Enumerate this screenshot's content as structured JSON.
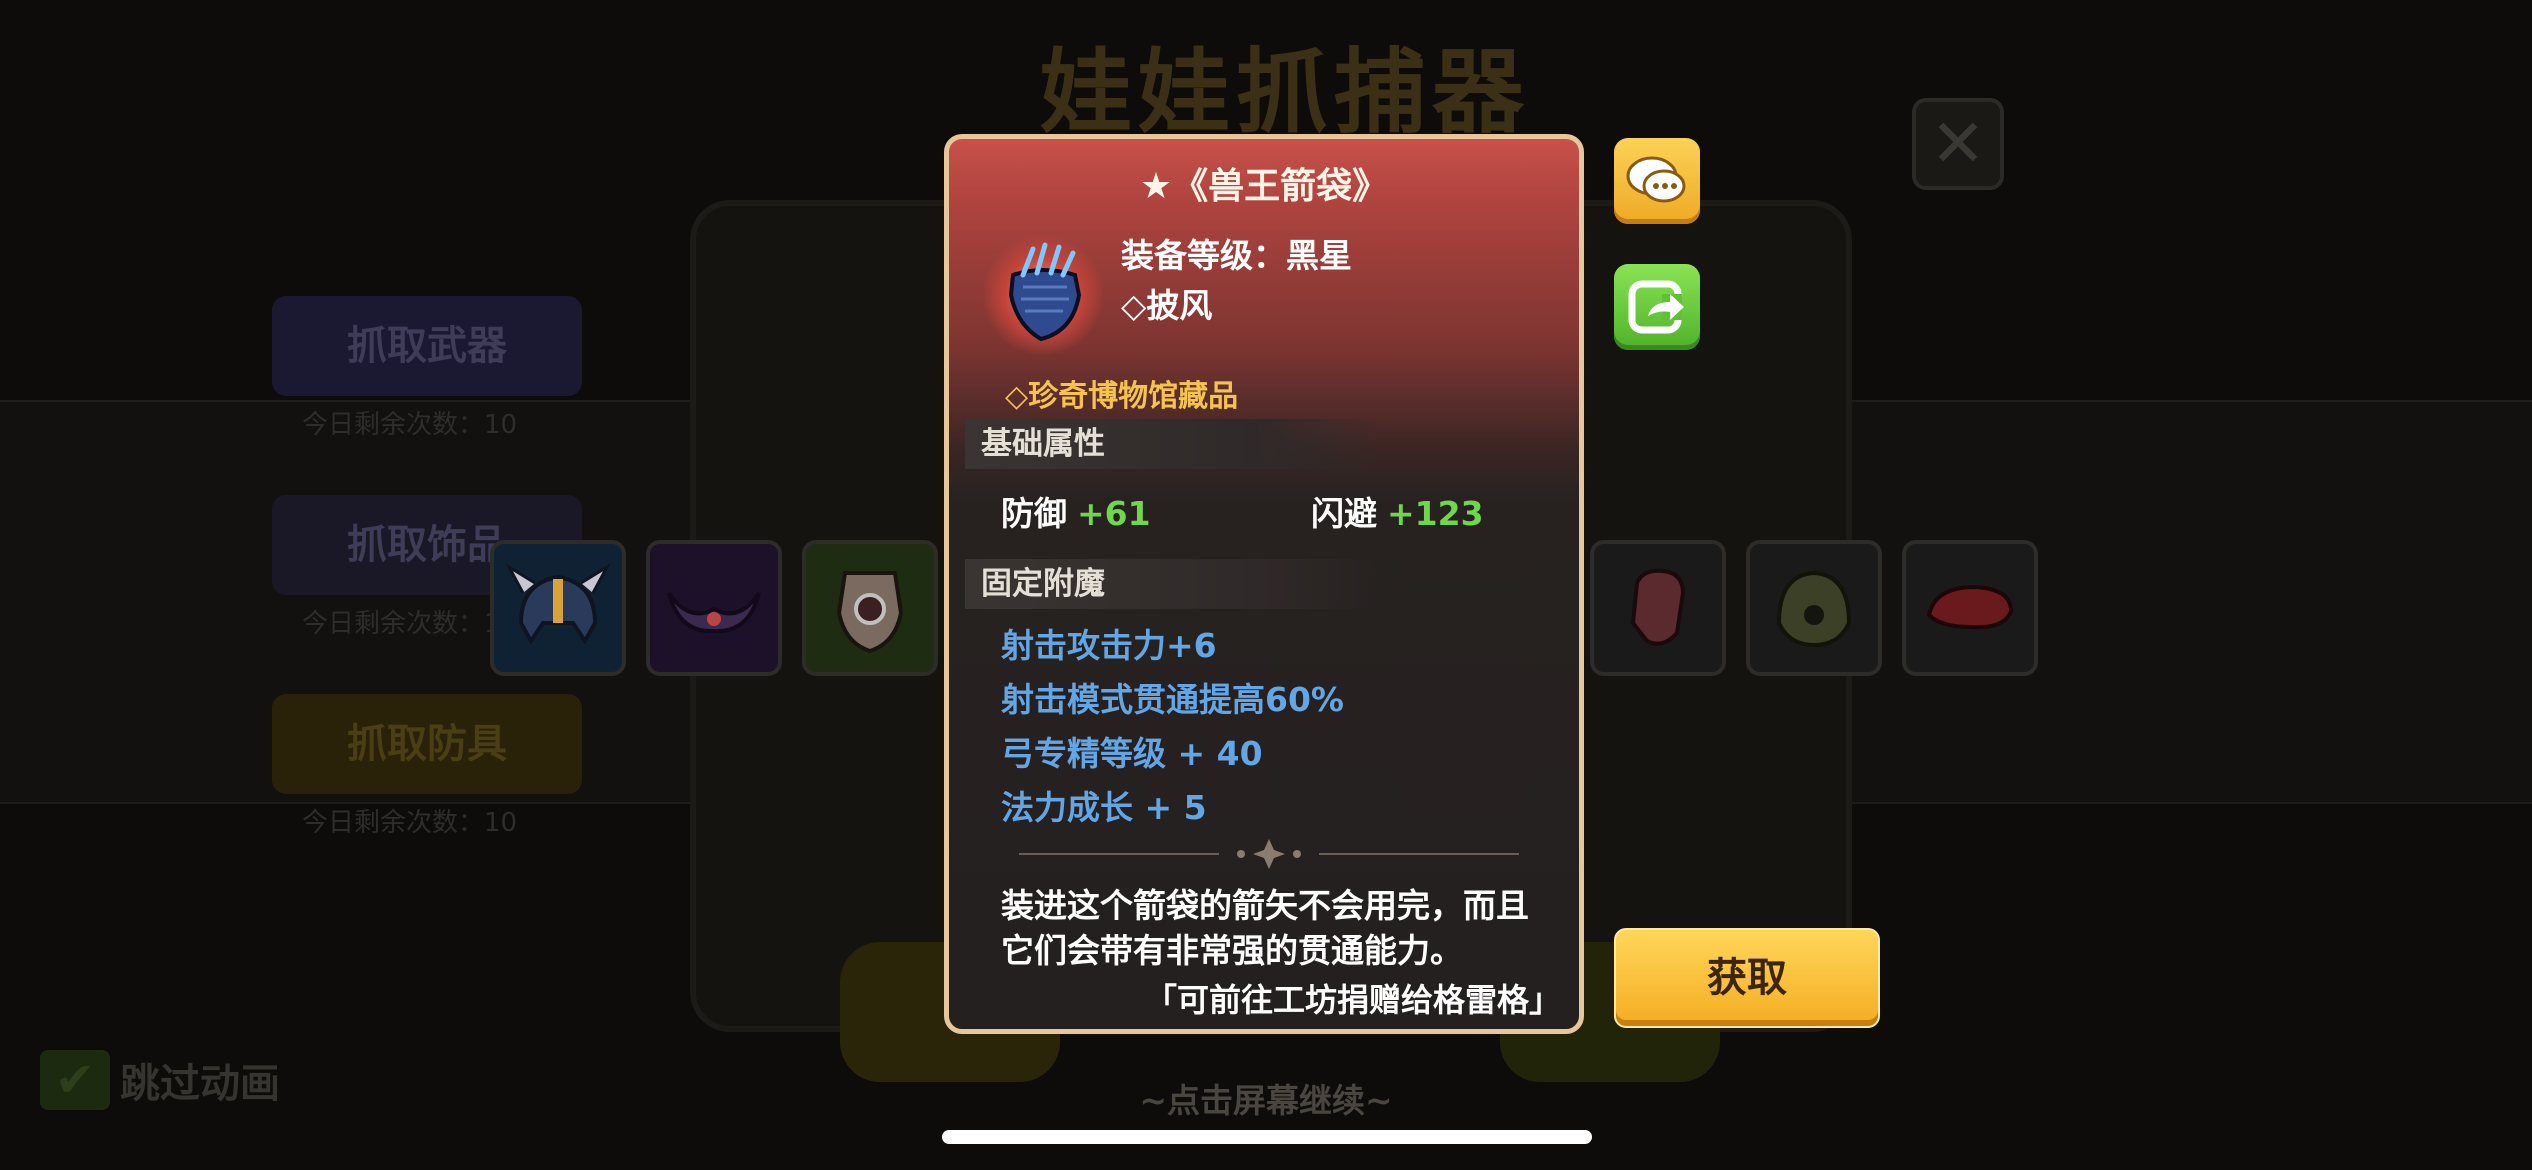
{
  "background": {
    "title": "娃娃抓捕器",
    "close_glyph": "✕",
    "side_buttons": [
      {
        "label": "抓取武器",
        "caption": "今日剩余次数：10"
      },
      {
        "label": "抓取饰品",
        "caption": "今日剩余次数：10"
      },
      {
        "label": "抓取防具",
        "caption": "今日剩余次数：10"
      }
    ],
    "skip_animation": "跳过动画",
    "continue_hint": "~点击屏幕继续~"
  },
  "modal": {
    "title": "★《兽王箭袋》",
    "level_text": "装备等级：黑星",
    "slot_text": "◇披风",
    "museum_text": "◇珍奇博物馆藏品",
    "base_section": "基础属性",
    "stats": [
      {
        "name": "防御",
        "value": "+61"
      },
      {
        "name": "闪避",
        "value": "+123"
      }
    ],
    "enchant_section": "固定附魔",
    "enchantments": [
      "射击攻击力+6",
      "射击模式贯通提高60%",
      "弓专精等级 + 40",
      "法力成长 + 5"
    ],
    "description_line1": "装进这个箭袋的箭矢不会用完，而且",
    "description_line2": "它们会带有非常强的贯通能力。",
    "hint": "「可前往工坊捐赠给格雷格」"
  },
  "actions": {
    "get_label": "获取"
  },
  "colors": {
    "gold_border": "#e7c69a",
    "header_red": "#c8514a",
    "stat_green": "#6fd64d",
    "enchant_blue": "#62a6e6",
    "museum_gold": "#f5c44f",
    "button_yellow": "#f4ad22",
    "button_green": "#4fb22a"
  },
  "icons": [
    "quiver-icon",
    "chat-icon",
    "share-icon",
    "helmet-icon",
    "mask-icon",
    "shield-icon",
    "glove-icon",
    "hood-icon",
    "beret-icon"
  ]
}
